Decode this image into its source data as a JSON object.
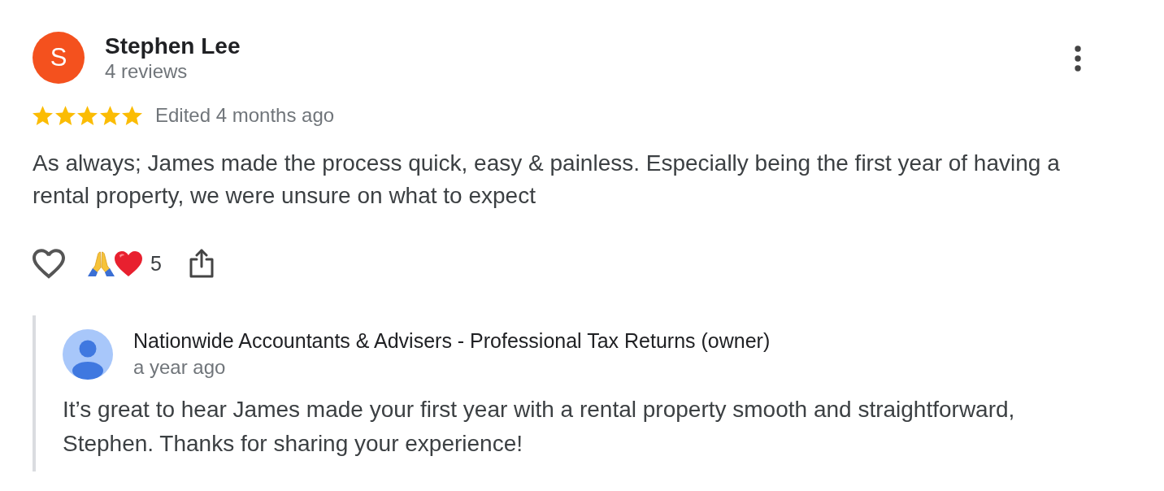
{
  "review": {
    "author": {
      "avatar_letter": "S",
      "name": "Stephen Lee",
      "review_count": "4 reviews"
    },
    "stars": 5,
    "time": "Edited 4 months ago",
    "text": "As always; James made the process quick, easy & painless. Especially being the first year of having a rental property, we were unsure on what to expect",
    "reactions": {
      "count": "5"
    }
  },
  "owner_response": {
    "name": "Nationwide Accountants & Advisers - Professional Tax Returns (owner)",
    "time": "a year ago",
    "text": "It’s great to hear James made your first year with a rental property smooth and straightforward, Stephen. Thanks for sharing your experience!"
  }
}
